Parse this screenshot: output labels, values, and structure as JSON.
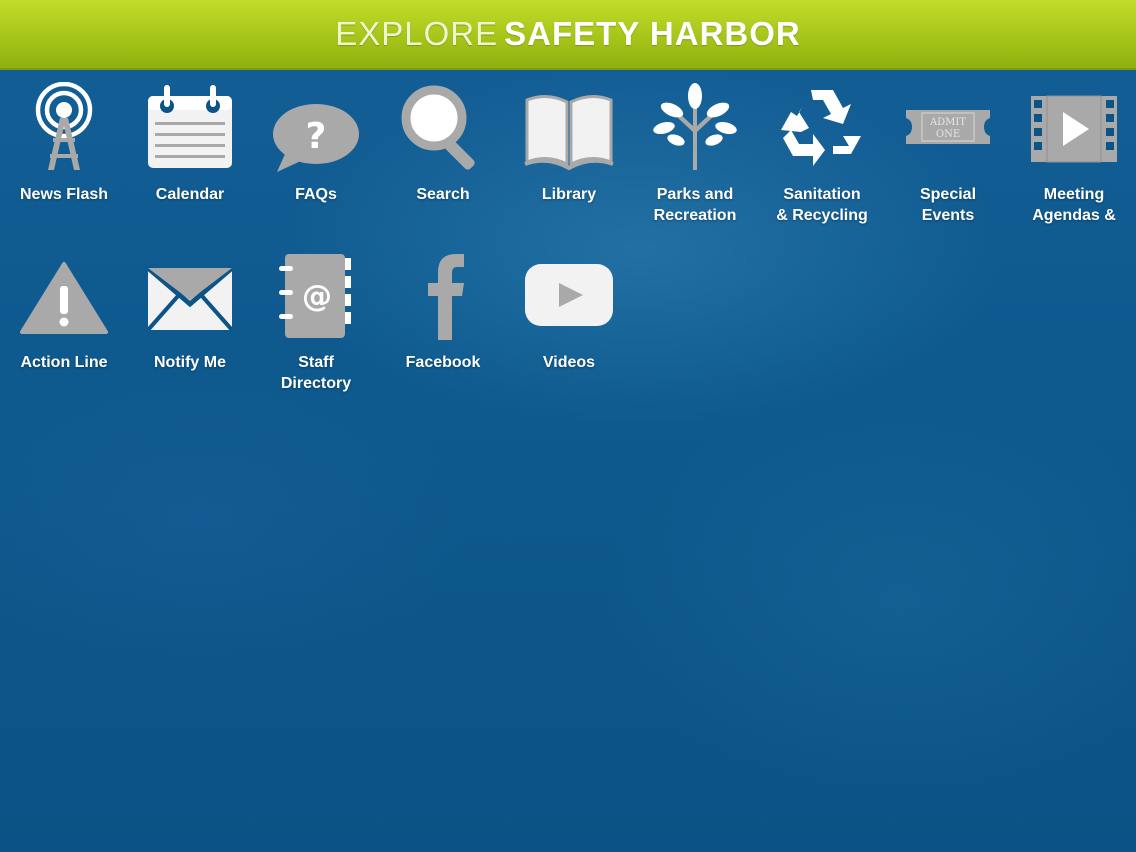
{
  "header": {
    "title_light": "EXPLORE",
    "title_bold": "SAFETY HARBOR",
    "bar_color": "#a6c51a"
  },
  "tiles": [
    {
      "label": "News Flash",
      "icon": "broadcast-tower-icon"
    },
    {
      "label": "Calendar",
      "icon": "calendar-icon"
    },
    {
      "label": "FAQs",
      "icon": "question-bubble-icon"
    },
    {
      "label": "Search",
      "icon": "magnifier-icon"
    },
    {
      "label": "Library",
      "icon": "open-book-icon"
    },
    {
      "label": "Parks and\nRecreation",
      "icon": "tree-icon"
    },
    {
      "label": "Sanitation\n& Recycling",
      "icon": "recycle-icon"
    },
    {
      "label": "Special\nEvents",
      "icon": "admit-one-ticket-icon",
      "ticket_line1": "ADMIT",
      "ticket_line2": "ONE"
    },
    {
      "label": "Meeting\nAgendas &",
      "icon": "video-play-icon"
    },
    {
      "label": "Action Line",
      "icon": "warning-icon"
    },
    {
      "label": "Notify Me",
      "icon": "envelope-icon"
    },
    {
      "label": "Staff\nDirectory",
      "icon": "address-book-icon"
    },
    {
      "label": "Facebook",
      "icon": "facebook-icon"
    },
    {
      "label": "Videos",
      "icon": "youtube-play-icon"
    }
  ],
  "colors": {
    "background": "#0c5486",
    "icon_gray": "#a9a9a9",
    "icon_white": "#f2f2f2"
  }
}
